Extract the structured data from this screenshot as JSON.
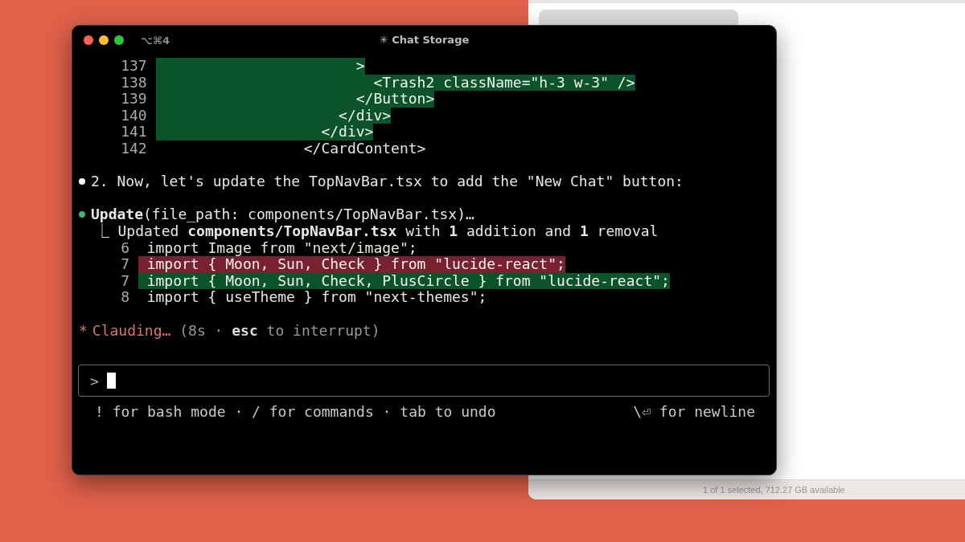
{
  "finder": {
    "status_text": "1 of 1 selected, 712.27 GB available"
  },
  "terminal": {
    "shortcut": "⌥⌘4",
    "title": "✳ Chat Storage",
    "code_lines": [
      {
        "number": "137",
        "kind": "added",
        "text": "                      >"
      },
      {
        "number": "138",
        "kind": "added",
        "text": "                        <Trash2 className=\"h-3 w-3\" />"
      },
      {
        "number": "139",
        "kind": "added",
        "text": "                      </Button>"
      },
      {
        "number": "140",
        "kind": "added",
        "text": "                    </div>"
      },
      {
        "number": "141",
        "kind": "added",
        "text": "                  </div>"
      },
      {
        "number": "142",
        "kind": "context",
        "text": "                </CardContent>"
      }
    ],
    "messages": [
      {
        "kind": "text",
        "color": "#ffffff",
        "text": "2. Now, let's update the TopNavBar.tsx to add the \"New Chat\" button:"
      },
      {
        "kind": "tool",
        "color": "#3fb86a",
        "tool": "Update",
        "args": "(file_path: components/TopNavBar.tsx)…",
        "summary": "⎿ Updated **components/TopNavBar.tsx** with **1** addition and **1** removal",
        "lines": [
          {
            "number": "6",
            "kind": "context",
            "text": "import Image from \"next/image\";"
          },
          {
            "number": "7",
            "kind": "removed",
            "text": "import { Moon, Sun, Check } from \"lucide-react\";"
          },
          {
            "number": "7",
            "kind": "added",
            "text": "import { Moon, Sun, Check, PlusCircle } from \"lucide-react\";"
          },
          {
            "number": "8",
            "kind": "context",
            "text": "import { useTheme } from \"next-themes\";"
          }
        ]
      }
    ],
    "status": {
      "spinner": "*",
      "label": "Clauding…",
      "detail": "(8s · **esc** to interrupt)"
    },
    "prompt": {
      "symbol": ">"
    },
    "hints": {
      "left": "! for bash mode · / for commands · tab to undo",
      "right": "\\⏎ for newline"
    }
  }
}
